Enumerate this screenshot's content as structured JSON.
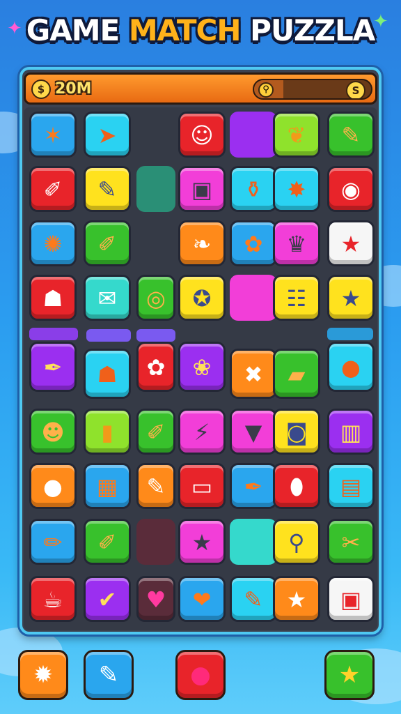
{
  "title": {
    "word1": "GAME",
    "word2": "MATCH",
    "word3": "PUZZLA"
  },
  "hud": {
    "score": "20M",
    "coin_icon": "coin-icon",
    "timer_icon": "timer-icon",
    "progress": 0.25
  },
  "colors": {
    "cyan": "#2ad2f2",
    "blue": "#2aa6ee",
    "red": "#e8242a",
    "yellow": "#ffe21e",
    "green": "#38c12c",
    "lime": "#8fe22c",
    "purple": "#9b2ff0",
    "magenta": "#f23ed8",
    "orange": "#ff8a1a",
    "white": "#f6f6f6",
    "teal": "#2a8f76",
    "maroon": "#5a2c3a",
    "aqua": "#35d9cc",
    "darkpurple": "#7a2ad8"
  },
  "board": {
    "rows": [
      [
        {
          "c": "blue",
          "icon": "starfish-icon",
          "g": "✶"
        },
        {
          "c": "cyan",
          "icon": "paper-plane-icon",
          "g": "➤"
        },
        {
          "c": "none"
        },
        {
          "c": "red",
          "icon": "face-icon",
          "g": "☺"
        },
        {
          "c": "purple",
          "icon": "",
          "g": ""
        },
        {
          "c": "lime",
          "icon": "leaf-icon",
          "g": "❦"
        },
        {
          "c": "green",
          "icon": "pencil-icon",
          "g": "✎"
        }
      ],
      [
        {
          "c": "red",
          "icon": "brush-icon",
          "g": "✐"
        },
        {
          "c": "yellow",
          "icon": "pen-icon",
          "g": "✎"
        },
        {
          "c": "teal",
          "icon": "",
          "g": ""
        },
        {
          "c": "magenta",
          "icon": "camera-icon",
          "g": "▣"
        },
        {
          "c": "cyan",
          "icon": "bottle-icon",
          "g": "⚱"
        },
        {
          "c": "cyan",
          "icon": "gem-icon",
          "g": "✸"
        },
        {
          "c": "red",
          "icon": "lips-icon",
          "g": "◉"
        }
      ],
      [
        {
          "c": "blue",
          "icon": "sun-icon",
          "g": "✺"
        },
        {
          "c": "green",
          "icon": "carrot-icon",
          "g": "✐"
        },
        {
          "c": "none"
        },
        {
          "c": "orange",
          "icon": "leaf-icon",
          "g": "❧"
        },
        {
          "c": "blue",
          "icon": "flower-icon",
          "g": "✿"
        },
        {
          "c": "magenta",
          "icon": "crown-icon",
          "g": "♛"
        },
        {
          "c": "white",
          "icon": "star-icon",
          "g": "★"
        }
      ],
      [
        {
          "c": "red",
          "icon": "cup-icon",
          "g": "☗"
        },
        {
          "c": "aqua",
          "icon": "envelope-icon",
          "g": "✉"
        },
        {
          "c": "green",
          "icon": "ring-icon",
          "g": "◎"
        },
        {
          "c": "yellow",
          "icon": "donut-icon",
          "g": "✪"
        },
        {
          "c": "magenta",
          "icon": "",
          "g": ""
        },
        {
          "c": "yellow",
          "icon": "radio-icon",
          "g": "☷"
        },
        {
          "c": "yellow",
          "icon": "star-icon",
          "g": "★"
        }
      ],
      [
        {
          "c": "purple",
          "icon": "pen-icon",
          "g": "✒"
        },
        {
          "c": "cyan",
          "icon": "bag-icon",
          "g": "☗"
        },
        {
          "c": "red",
          "icon": "bulb-icon",
          "g": "✿"
        },
        {
          "c": "purple",
          "icon": "flower-icon",
          "g": "❀"
        },
        {
          "c": "orange",
          "icon": "cross-icon",
          "g": "✖"
        },
        {
          "c": "green",
          "icon": "bag-icon",
          "g": "▰"
        },
        {
          "c": "cyan",
          "icon": "apple-icon",
          "g": "●"
        }
      ],
      [
        {
          "c": "green",
          "icon": "monkey-icon",
          "g": "☻"
        },
        {
          "c": "lime",
          "icon": "jar-icon",
          "g": "▮"
        },
        {
          "c": "green",
          "icon": "carrot-icon",
          "g": "✐"
        },
        {
          "c": "magenta",
          "icon": "shield-icon",
          "g": "⚡"
        },
        {
          "c": "magenta",
          "icon": "carrot-icon",
          "g": "▼"
        },
        {
          "c": "yellow",
          "icon": "camera-icon",
          "g": "◙"
        },
        {
          "c": "purple",
          "icon": "book-icon",
          "g": "▥"
        }
      ],
      [
        {
          "c": "orange",
          "icon": "leaf-icon",
          "g": "●"
        },
        {
          "c": "blue",
          "icon": "box-icon",
          "g": "▦"
        },
        {
          "c": "orange",
          "icon": "marker-icon",
          "g": "✎"
        },
        {
          "c": "red",
          "icon": "eraser-icon",
          "g": "▭"
        },
        {
          "c": "blue",
          "icon": "pen-icon",
          "g": "✒"
        },
        {
          "c": "red",
          "icon": "popsicle-icon",
          "g": "⬮"
        },
        {
          "c": "cyan",
          "icon": "gift-icon",
          "g": "▤"
        }
      ],
      [
        {
          "c": "blue",
          "icon": "pencil-icon",
          "g": "✏"
        },
        {
          "c": "green",
          "icon": "carrot-icon",
          "g": "✐"
        },
        {
          "c": "maroon",
          "icon": "",
          "g": ""
        },
        {
          "c": "magenta",
          "icon": "star-icon",
          "g": "★"
        },
        {
          "c": "aqua",
          "icon": "",
          "g": ""
        },
        {
          "c": "yellow",
          "icon": "lollipop-icon",
          "g": "⚲"
        },
        {
          "c": "green",
          "icon": "gift-icon",
          "g": "✂"
        }
      ],
      [
        {
          "c": "red",
          "icon": "teapot-icon",
          "g": "☕"
        },
        {
          "c": "purple",
          "icon": "check-icon",
          "g": "✔"
        },
        {
          "c": "maroon",
          "icon": "heart-icon",
          "g": "♥"
        },
        {
          "c": "blue",
          "icon": "heart-icon",
          "g": "❤"
        },
        {
          "c": "cyan",
          "icon": "pencil-icon",
          "g": "✎"
        },
        {
          "c": "orange",
          "icon": "star-icon",
          "g": "★"
        },
        {
          "c": "white",
          "icon": "jar-icon",
          "g": "▣"
        }
      ]
    ]
  },
  "buttons": [
    {
      "name": "gear-button",
      "icon": "gear-icon",
      "g": "✹",
      "c": "orange"
    },
    {
      "name": "pencil-button",
      "icon": "pencil-icon",
      "g": "✎",
      "c": "blue"
    },
    {
      "name": "berry-button",
      "icon": "berry-icon",
      "g": "●",
      "c": "red"
    },
    {
      "name": "star-button",
      "icon": "star-icon",
      "g": "★",
      "c": "green"
    }
  ]
}
